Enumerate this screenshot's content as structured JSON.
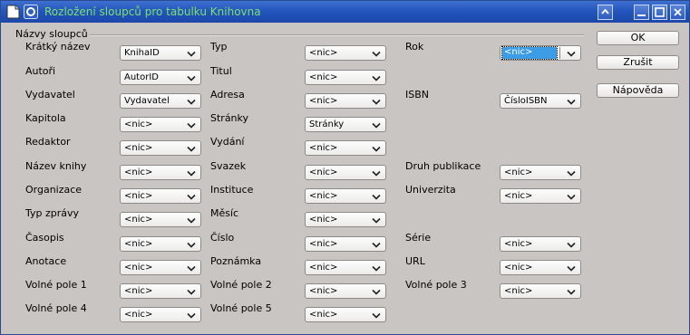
{
  "window": {
    "title": "Rozložení sloupců pro tabulku Knihovna",
    "icon": "document-icon",
    "controls": [
      "collapse-icon",
      "minimize-icon",
      "maximize-icon",
      "close-icon"
    ]
  },
  "group": {
    "label": "Názvy sloupců"
  },
  "fields": [
    {
      "label": "Krátký název",
      "value": "KnihaID"
    },
    {
      "label": "Typ",
      "value": "<nic>"
    },
    {
      "label": "Rok",
      "value": "<nic>",
      "focused": true
    },
    {
      "label": "Autoři",
      "value": "AutorID"
    },
    {
      "label": "Titul",
      "value": "<nic>"
    },
    {
      "label": "Vydavatel",
      "value": "Vydavatel"
    },
    {
      "label": "Adresa",
      "value": "<nic>"
    },
    {
      "label": "ISBN",
      "value": "ČísloISBN"
    },
    {
      "label": "Kapitola",
      "value": "<nic>"
    },
    {
      "label": "Stránky",
      "value": "Stránky"
    },
    {
      "label": "Redaktor",
      "value": "<nic>"
    },
    {
      "label": "Vydání",
      "value": "<nic>"
    },
    {
      "label": "Název knihy",
      "value": "<nic>"
    },
    {
      "label": "Svazek",
      "value": "<nic>"
    },
    {
      "label": "Druh publikace",
      "value": "<nic>"
    },
    {
      "label": "Organizace",
      "value": "<nic>"
    },
    {
      "label": "Instituce",
      "value": "<nic>"
    },
    {
      "label": "Univerzita",
      "value": "<nic>"
    },
    {
      "label": "Typ zprávy",
      "value": "<nic>"
    },
    {
      "label": "Měsíc",
      "value": "<nic>"
    },
    {
      "label": "Časopis",
      "value": "<nic>"
    },
    {
      "label": "Číslo",
      "value": "<nic>"
    },
    {
      "label": "Série",
      "value": "<nic>"
    },
    {
      "label": "Anotace",
      "value": "<nic>"
    },
    {
      "label": "Poznámka",
      "value": "<nic>"
    },
    {
      "label": "URL",
      "value": "<nic>"
    },
    {
      "label": "Volné pole 1",
      "value": "<nic>"
    },
    {
      "label": "Volné pole 2",
      "value": "<nic>"
    },
    {
      "label": "Volné pole 3",
      "value": "<nic>"
    },
    {
      "label": "Volné pole 4",
      "value": "<nic>"
    },
    {
      "label": "Volné pole 5",
      "value": "<nic>"
    }
  ],
  "buttons": {
    "ok": "OK",
    "cancel": "Zrušit",
    "help": "Nápověda"
  },
  "colors": {
    "titlebar": "#2456bd",
    "title_text": "#7de06b",
    "dialog_bg": "#c9c5c2",
    "selection": "#3d9ce6"
  }
}
